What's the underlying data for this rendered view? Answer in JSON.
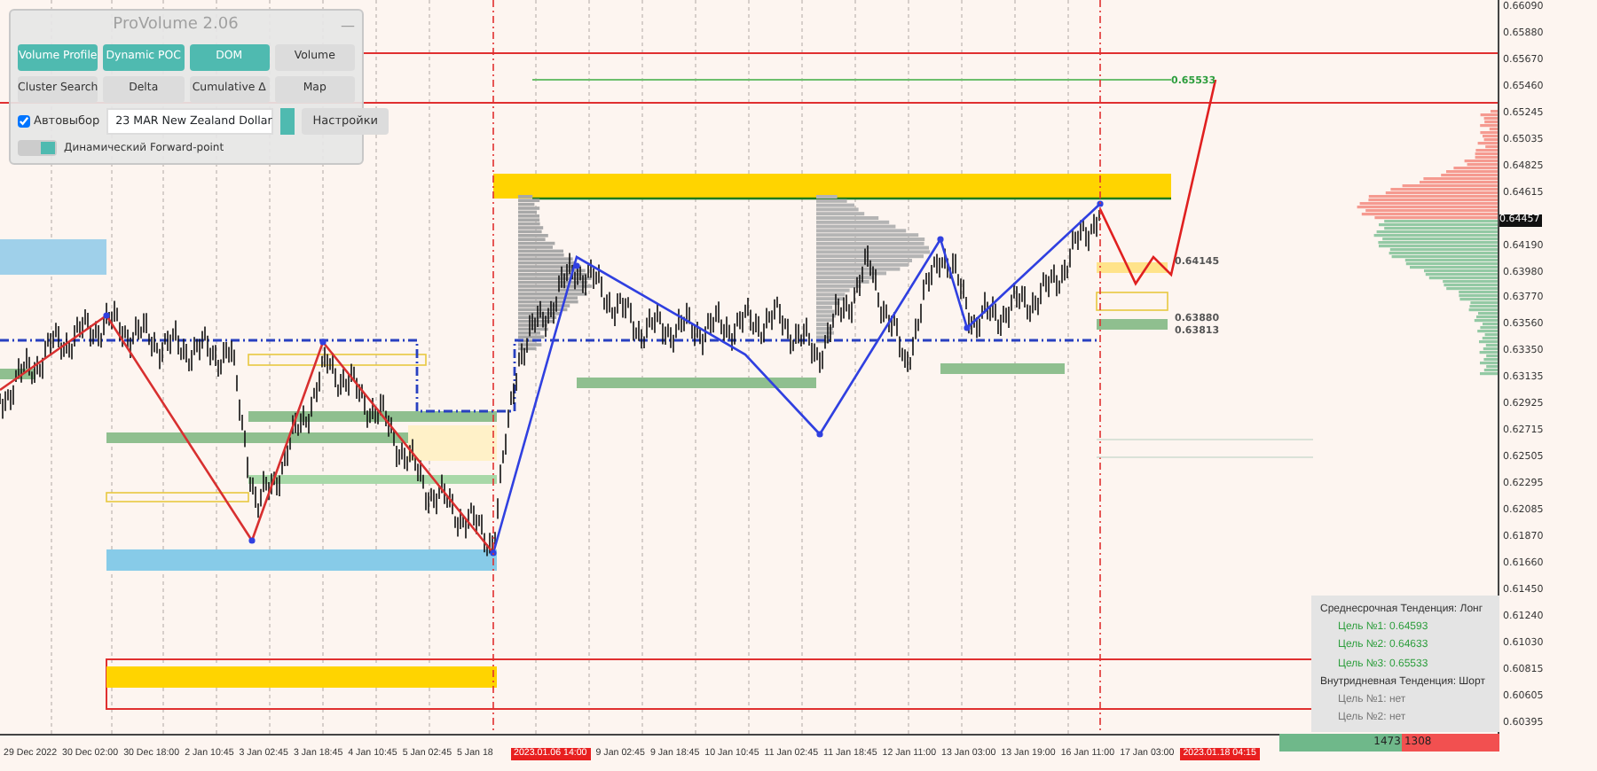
{
  "panel": {
    "title": "ProVolume 2.06",
    "minimize": "—",
    "buttons": [
      {
        "label": "Volume Profile",
        "active": true
      },
      {
        "label": "Dynamic POC",
        "active": true
      },
      {
        "label": "DOM",
        "active": true
      },
      {
        "label": "Volume",
        "active": false
      },
      {
        "label": "Cluster Search",
        "active": false
      },
      {
        "label": "Delta",
        "active": false
      },
      {
        "label": "Cumulative Δ",
        "active": false
      },
      {
        "label": "Map",
        "active": false
      }
    ],
    "autoselect": {
      "label": "Автовыбор",
      "checked": true
    },
    "instrument": {
      "value": "23 MAR New Zealand Dollar"
    },
    "settings_button": "Настройки",
    "forward_point": {
      "label": "Динамический Forward-point",
      "on": true
    }
  },
  "chart_labels": [
    {
      "text": "0.65533",
      "color": "#2e9e3e"
    },
    {
      "text": "0.64145",
      "color": "#555555"
    },
    {
      "text": "0.63880",
      "color": "#555555"
    },
    {
      "text": "0.63813",
      "color": "#555555"
    }
  ],
  "info_box": {
    "lines": [
      {
        "text": "Среднесрочная Тенденция: Лонг",
        "kind": "heading"
      },
      {
        "text": "Цель №1: 0.64593",
        "kind": "target"
      },
      {
        "text": "Цель №2: 0.64633",
        "kind": "target"
      },
      {
        "text": "Цель №3: 0.65533",
        "kind": "target"
      },
      {
        "text": "Внутридневная Тенденция: Шорт",
        "kind": "heading"
      },
      {
        "text": "Цель №1: нет",
        "kind": "none"
      },
      {
        "text": "Цель №2: нет",
        "kind": "none"
      }
    ]
  },
  "balance_bar": {
    "buy": "1473",
    "sell": "1308"
  },
  "price_axis": {
    "labels": [
      {
        "text": "0.66090",
        "kind": "tick"
      },
      {
        "text": "0.65880",
        "kind": "tick"
      },
      {
        "text": "0.65670",
        "kind": "tick"
      },
      {
        "text": "0.65460",
        "kind": "tick"
      },
      {
        "text": "0.65245",
        "kind": "tick"
      },
      {
        "text": "0.65035",
        "kind": "tick"
      },
      {
        "text": "0.64825",
        "kind": "tick"
      },
      {
        "text": "0.64615",
        "kind": "tick"
      },
      {
        "text": "0.64457",
        "kind": "current"
      },
      {
        "text": "0.64190",
        "kind": "tick"
      },
      {
        "text": "0.63980",
        "kind": "tick"
      },
      {
        "text": "0.63770",
        "kind": "tick"
      },
      {
        "text": "0.63560",
        "kind": "tick"
      },
      {
        "text": "0.63350",
        "kind": "tick"
      },
      {
        "text": "0.63135",
        "kind": "tick"
      },
      {
        "text": "0.62925",
        "kind": "tick"
      },
      {
        "text": "0.62715",
        "kind": "tick"
      },
      {
        "text": "0.62505",
        "kind": "tick"
      },
      {
        "text": "0.62295",
        "kind": "tick"
      },
      {
        "text": "0.62085",
        "kind": "tick"
      },
      {
        "text": "0.61870",
        "kind": "tick"
      },
      {
        "text": "0.61660",
        "kind": "tick"
      },
      {
        "text": "0.61450",
        "kind": "tick"
      },
      {
        "text": "0.61240",
        "kind": "tick"
      },
      {
        "text": "0.61030",
        "kind": "tick"
      },
      {
        "text": "0.60815",
        "kind": "tick"
      },
      {
        "text": "0.60605",
        "kind": "tick"
      },
      {
        "text": "0.60395",
        "kind": "tick"
      }
    ]
  },
  "time_axis": {
    "labels": [
      {
        "text": "29 Dec 2022",
        "highlighted": false
      },
      {
        "text": "30 Dec 02:00",
        "highlighted": false
      },
      {
        "text": "30 Dec 18:00",
        "highlighted": false
      },
      {
        "text": "2 Jan 10:45",
        "highlighted": false
      },
      {
        "text": "3 Jan 02:45",
        "highlighted": false
      },
      {
        "text": "3 Jan 18:45",
        "highlighted": false
      },
      {
        "text": "4 Jan 10:45",
        "highlighted": false
      },
      {
        "text": "5 Jan 02:45",
        "highlighted": false
      },
      {
        "text": "5 Jan 18",
        "highlighted": false
      },
      {
        "text": "2023.01.06 14:00",
        "highlighted": true
      },
      {
        "text": "9 Jan 02:45",
        "highlighted": false
      },
      {
        "text": "9 Jan 18:45",
        "highlighted": false
      },
      {
        "text": "10 Jan 10:45",
        "highlighted": false
      },
      {
        "text": "11 Jan 02:45",
        "highlighted": false
      },
      {
        "text": "11 Jan 18:45",
        "highlighted": false
      },
      {
        "text": "12 Jan 11:00",
        "highlighted": false
      },
      {
        "text": "13 Jan 03:00",
        "highlighted": false
      },
      {
        "text": "13 Jan 19:00",
        "highlighted": false
      },
      {
        "text": "16 Jan 11:00",
        "highlighted": false
      },
      {
        "text": "17 Jan 03:00",
        "highlighted": false
      },
      {
        "text": "2023.01.18 04:15",
        "highlighted": true
      }
    ]
  }
}
